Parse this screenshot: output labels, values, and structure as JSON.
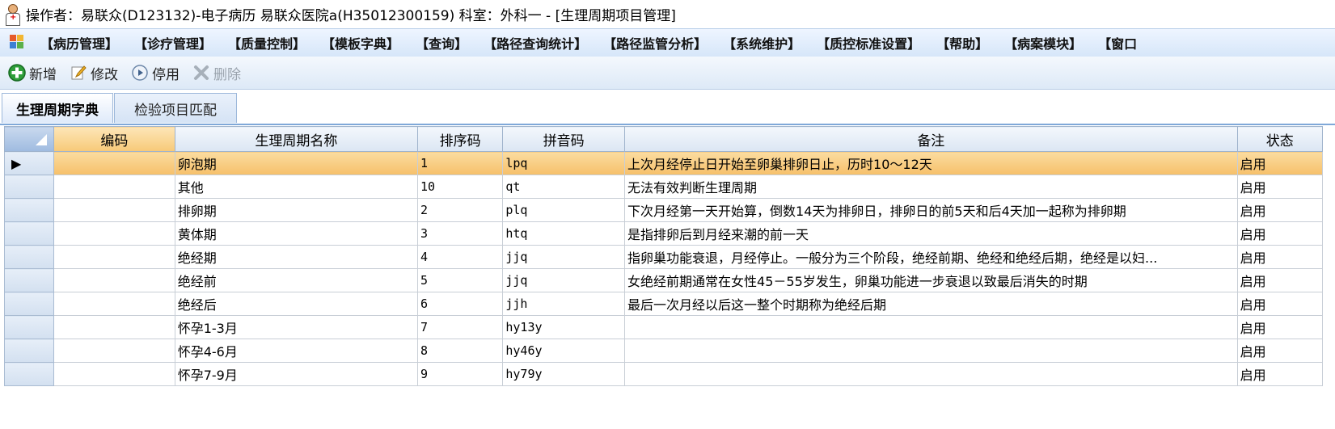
{
  "window": {
    "title": "操作者：易联众(D123132)-电子病历  易联众医院a(H35012300159)  科室：外科一 - [生理周期项目管理]"
  },
  "menu": {
    "items": [
      "【病历管理】",
      "【诊疗管理】",
      "【质量控制】",
      "【模板字典】",
      "【查询】",
      "【路径查询统计】",
      "【路径监管分析】",
      "【系统维护】",
      "【质控标准设置】",
      "【帮助】",
      "【病案模块】",
      "【窗口"
    ]
  },
  "toolbar": {
    "add_label": "新增",
    "edit_label": "修改",
    "disable_label": "停用",
    "delete_label": "删除"
  },
  "tabs": {
    "active": "生理周期字典",
    "second": "检验项目匹配"
  },
  "table": {
    "headers": [
      "编码",
      "生理周期名称",
      "排序码",
      "拼音码",
      "备注",
      "状态"
    ],
    "selected_row": 0,
    "rows": [
      {
        "code": "",
        "name": "卵泡期",
        "sort": "1",
        "pinyin": "lpq",
        "remark": "上次月经停止日开始至卵巢排卵日止，历时10～12天",
        "status": "启用"
      },
      {
        "code": "",
        "name": "其他",
        "sort": "10",
        "pinyin": "qt",
        "remark": "无法有效判断生理周期",
        "status": "启用"
      },
      {
        "code": "",
        "name": "排卵期",
        "sort": "2",
        "pinyin": "plq",
        "remark": "下次月经第一天开始算，倒数14天为排卵日，排卵日的前5天和后4天加一起称为排卵期",
        "status": "启用"
      },
      {
        "code": "",
        "name": "黄体期",
        "sort": "3",
        "pinyin": "htq",
        "remark": "是指排卵后到月经来潮的前一天",
        "status": "启用"
      },
      {
        "code": "",
        "name": "绝经期",
        "sort": "4",
        "pinyin": "jjq",
        "remark": "指卵巢功能衰退，月经停止。一般分为三个阶段，绝经前期、绝经和绝经后期，绝经是以妇...",
        "status": "启用"
      },
      {
        "code": "",
        "name": "绝经前",
        "sort": "5",
        "pinyin": "jjq",
        "remark": "女绝经前期通常在女性45－55岁发生，卵巢功能进一步衰退以致最后消失的时期",
        "status": "启用"
      },
      {
        "code": "",
        "name": "绝经后",
        "sort": "6",
        "pinyin": "jjh",
        "remark": "最后一次月经以后这一整个时期称为绝经后期",
        "status": "启用"
      },
      {
        "code": "",
        "name": "怀孕1-3月",
        "sort": "7",
        "pinyin": "hy13y",
        "remark": "",
        "status": "启用"
      },
      {
        "code": "",
        "name": "怀孕4-6月",
        "sort": "8",
        "pinyin": "hy46y",
        "remark": "",
        "status": "启用"
      },
      {
        "code": "",
        "name": "怀孕7-9月",
        "sort": "9",
        "pinyin": "hy79y",
        "remark": "",
        "status": "启用"
      }
    ]
  }
}
